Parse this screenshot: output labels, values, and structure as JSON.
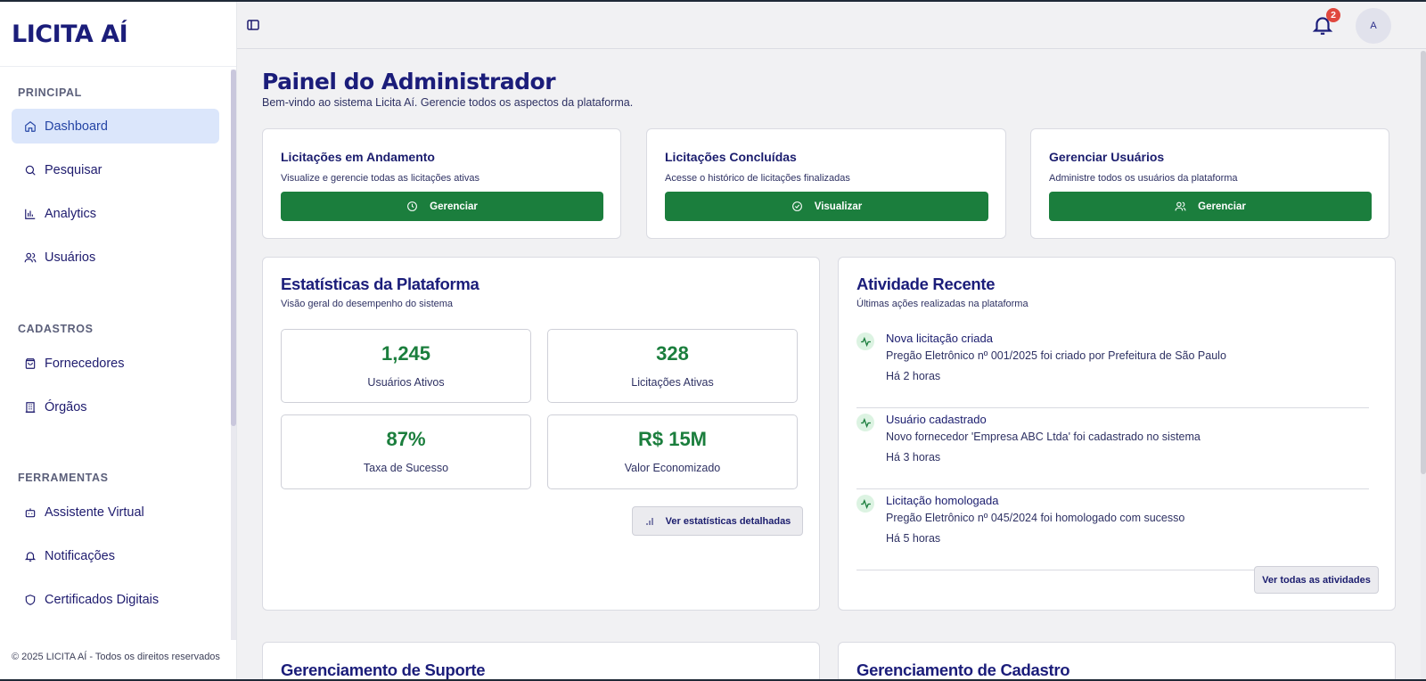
{
  "brand": "LICITA AÍ",
  "sidebar": {
    "sections": [
      {
        "title": "PRINCIPAL",
        "items": [
          {
            "label": "Dashboard",
            "icon": "home-icon",
            "active": true
          },
          {
            "label": "Pesquisar",
            "icon": "search-icon"
          },
          {
            "label": "Analytics",
            "icon": "bar-chart-icon"
          },
          {
            "label": "Usuários",
            "icon": "users-icon"
          }
        ]
      },
      {
        "title": "CADASTROS",
        "items": [
          {
            "label": "Fornecedores",
            "icon": "shopping-bag-icon"
          },
          {
            "label": "Órgãos",
            "icon": "building-icon"
          }
        ]
      },
      {
        "title": "FERRAMENTAS",
        "items": [
          {
            "label": "Assistente Virtual",
            "icon": "bot-icon"
          },
          {
            "label": "Notificações",
            "icon": "bell-icon"
          },
          {
            "label": "Certificados Digitais",
            "icon": "shield-icon"
          }
        ]
      }
    ],
    "copyright": "© 2025 LICITA AÍ - Todos os direitos reservados"
  },
  "topbar": {
    "notification_count": "2",
    "avatar_initial": "A"
  },
  "page": {
    "title": "Painel do Administrador",
    "subtitle": "Bem-vindo ao sistema Licita Aí. Gerencie todos os aspectos da plataforma."
  },
  "quick_cards": [
    {
      "title": "Licitações em Andamento",
      "desc": "Visualize e gerencie todas as licitações ativas",
      "button": "Gerenciar",
      "icon": "clock-icon"
    },
    {
      "title": "Licitações Concluídas",
      "desc": "Acesse o histórico de licitações finalizadas",
      "button": "Visualizar",
      "icon": "check-circle-icon"
    },
    {
      "title": "Gerenciar Usuários",
      "desc": "Administre todos os usuários da plataforma",
      "button": "Gerenciar",
      "icon": "users-icon"
    }
  ],
  "stats": {
    "title": "Estatísticas da Plataforma",
    "subtitle": "Visão geral do desempenho do sistema",
    "items": [
      {
        "value": "1,245",
        "label": "Usuários Ativos"
      },
      {
        "value": "328",
        "label": "Licitações Ativas"
      },
      {
        "value": "87%",
        "label": "Taxa de Sucesso"
      },
      {
        "value": "R$ 15M",
        "label": "Valor Economizado"
      }
    ],
    "button": "Ver estatísticas detalhadas"
  },
  "activity": {
    "title": "Atividade Recente",
    "subtitle": "Últimas ações realizadas na plataforma",
    "items": [
      {
        "title": "Nova licitação criada",
        "desc": "Pregão Eletrônico nº 001/2025 foi criado por Prefeitura de São Paulo",
        "when": "Há 2 horas"
      },
      {
        "title": "Usuário cadastrado",
        "desc": "Novo fornecedor 'Empresa ABC Ltda' foi cadastrado no sistema",
        "when": "Há 3 horas"
      },
      {
        "title": "Licitação homologada",
        "desc": "Pregão Eletrônico nº 045/2024 foi homologado com sucesso",
        "when": "Há 5 horas"
      }
    ],
    "button": "Ver todas as atividades"
  },
  "bottom_sections": {
    "support": "Gerenciamento de Suporte",
    "registry": "Gerenciamento de Cadastro"
  },
  "colors": {
    "brand_navy": "#1b1d7a",
    "accent_green": "#1b7e3d",
    "active_nav_bg": "#dbe6fb",
    "badge_red": "#e0483e"
  }
}
